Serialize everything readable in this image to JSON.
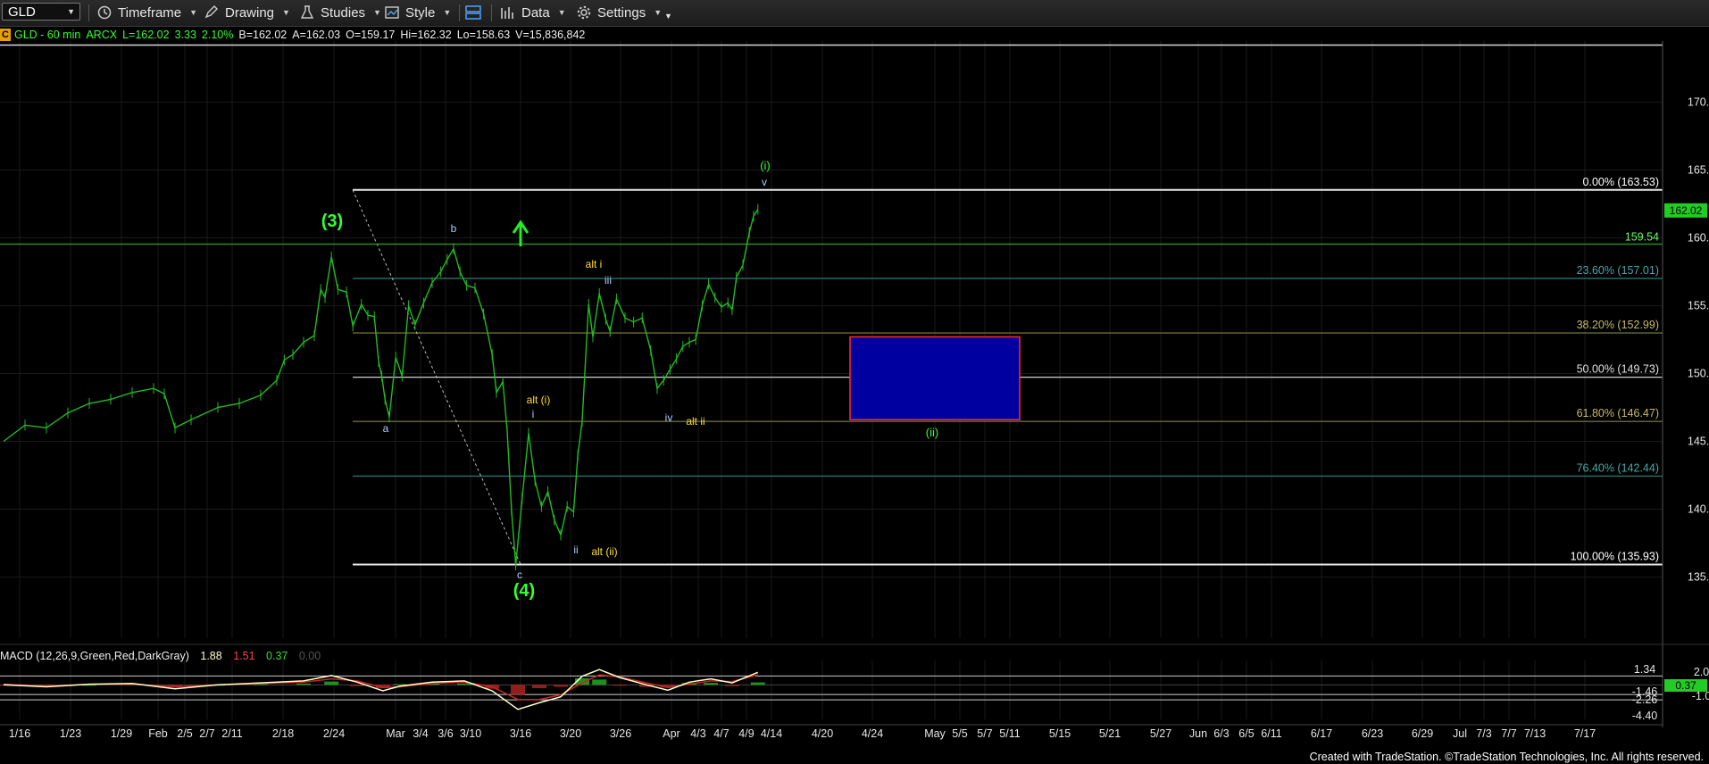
{
  "toolbar": {
    "symbol": "GLD",
    "items": [
      "Timeframe",
      "Drawing",
      "Studies",
      "Style",
      "Data",
      "Settings"
    ]
  },
  "infobar": {
    "badge": "C",
    "symbol_desc": "GLD - 60 min",
    "exchange": "ARCX",
    "last": "L=162.02",
    "change": "3.33",
    "pct": "2.10%",
    "bid": "B=162.02",
    "ask": "A=162.03",
    "open": "O=159.17",
    "high": "Hi=162.32",
    "low": "Lo=158.63",
    "volume": "V=15,836,842"
  },
  "macd_header": {
    "label": "MACD (12,26,9,Green,Red,DarkGray)",
    "macd": "1.88",
    "signal": "1.51",
    "hist": "0.37",
    "zero": "0.00"
  },
  "footer": "Created with TradeStation. ©TradeStation Technologies, Inc. All rights reserved.",
  "colors": {
    "price_up": "#22bb22",
    "price_label": "#33ff33",
    "fib_line": "#e0e0e0",
    "target_box_fill": "#0000a0",
    "target_box_border": "#ff2a2a",
    "macd_line": "#ffffcc",
    "signal_line": "#cc2222",
    "hist_pos": "#22aa22",
    "hist_neg": "#aa2222"
  },
  "chart_data": {
    "type": "line",
    "title": "GLD - 60 min",
    "ylim": [
      130.5,
      174.5
    ],
    "y_ticks": [
      135.0,
      140.0,
      145.0,
      150.0,
      155.0,
      160.0,
      165.0,
      170.0
    ],
    "x_labels": [
      "1/16",
      "1/23",
      "1/29",
      "Feb",
      "2/5",
      "2/7",
      "2/11",
      "2/18",
      "2/24",
      "Mar",
      "3/4",
      "3/6",
      "3/10",
      "3/16",
      "3/20",
      "3/26",
      "Apr",
      "4/3",
      "4/7",
      "4/9",
      "4/14",
      "4/20",
      "4/24",
      "May",
      "5/5",
      "5/7",
      "5/11",
      "5/15",
      "5/21",
      "5/27",
      "Jun",
      "6/3",
      "6/5",
      "6/11",
      "6/17",
      "6/23",
      "6/29",
      "Jul",
      "7/3",
      "7/7",
      "7/13",
      "7/17"
    ],
    "price_path": [
      [
        0,
        145.0
      ],
      [
        20,
        146.2
      ],
      [
        40,
        146.0
      ],
      [
        60,
        147.1
      ],
      [
        80,
        147.8
      ],
      [
        100,
        148.1
      ],
      [
        120,
        148.6
      ],
      [
        140,
        148.9
      ],
      [
        150,
        148.5
      ],
      [
        160,
        146.0
      ],
      [
        175,
        146.6
      ],
      [
        200,
        147.5
      ],
      [
        220,
        147.8
      ],
      [
        240,
        148.4
      ],
      [
        255,
        149.5
      ],
      [
        262,
        151.0
      ],
      [
        270,
        151.4
      ],
      [
        280,
        152.3
      ],
      [
        290,
        152.8
      ],
      [
        296,
        156.2
      ],
      [
        300,
        155.6
      ],
      [
        306,
        158.6
      ],
      [
        312,
        156.2
      ],
      [
        320,
        156.0
      ],
      [
        326,
        153.5
      ],
      [
        334,
        155.1
      ],
      [
        340,
        154.3
      ],
      [
        346,
        154.2
      ],
      [
        350,
        150.9
      ],
      [
        353,
        149.8
      ],
      [
        356,
        148.1
      ],
      [
        360,
        146.8
      ],
      [
        366,
        151.2
      ],
      [
        372,
        149.8
      ],
      [
        378,
        155.0
      ],
      [
        384,
        153.6
      ],
      [
        392,
        155.2
      ],
      [
        400,
        156.7
      ],
      [
        408,
        157.5
      ],
      [
        414,
        158.4
      ],
      [
        420,
        159.2
      ],
      [
        426,
        157.5
      ],
      [
        432,
        156.5
      ],
      [
        440,
        156.3
      ],
      [
        448,
        154.4
      ],
      [
        456,
        151.4
      ],
      [
        460,
        148.6
      ],
      [
        466,
        149.4
      ],
      [
        470,
        145.8
      ],
      [
        474,
        140.0
      ],
      [
        478,
        135.9
      ],
      [
        484,
        140.8
      ],
      [
        490,
        145.6
      ],
      [
        496,
        142.1
      ],
      [
        502,
        140.2
      ],
      [
        508,
        141.3
      ],
      [
        514,
        139.2
      ],
      [
        520,
        138.1
      ],
      [
        526,
        140.2
      ],
      [
        532,
        139.8
      ],
      [
        536,
        144.0
      ],
      [
        540,
        146.5
      ],
      [
        546,
        155.1
      ],
      [
        550,
        152.7
      ],
      [
        556,
        155.9
      ],
      [
        562,
        154.0
      ],
      [
        566,
        153.1
      ],
      [
        572,
        155.5
      ],
      [
        580,
        154.1
      ],
      [
        588,
        153.8
      ],
      [
        596,
        154.1
      ],
      [
        604,
        151.7
      ],
      [
        610,
        148.9
      ],
      [
        616,
        149.5
      ],
      [
        622,
        150.3
      ],
      [
        628,
        151.1
      ],
      [
        634,
        152.0
      ],
      [
        640,
        152.3
      ],
      [
        646,
        152.5
      ],
      [
        652,
        155.0
      ],
      [
        658,
        156.6
      ],
      [
        664,
        155.6
      ],
      [
        670,
        154.9
      ],
      [
        676,
        155.2
      ],
      [
        680,
        154.7
      ],
      [
        684,
        157.1
      ],
      [
        690,
        158.0
      ],
      [
        696,
        160.4
      ],
      [
        700,
        161.6
      ],
      [
        704,
        162.1
      ]
    ],
    "fib_levels": [
      {
        "label": "0.00% (163.53)",
        "price": 163.53
      },
      {
        "label": "23.60% (157.01)",
        "price": 157.01
      },
      {
        "label": "38.20% (152.99)",
        "price": 152.99
      },
      {
        "label": "50.00% (149.73)",
        "price": 149.73
      },
      {
        "label": "61.80% (146.47)",
        "price": 146.47
      },
      {
        "label": "76.40% (142.44)",
        "price": 142.44
      },
      {
        "label": "100.00% (135.93)",
        "price": 135.93
      }
    ],
    "top_line_price": 174.2,
    "support_line": {
      "label": "159.54",
      "price": 159.54
    },
    "last_price_label": "162.02",
    "target_box": {
      "price_high": 152.7,
      "price_low": 146.6
    },
    "wave_labels": [
      {
        "text": "(3)",
        "color": "#33ff33",
        "big": true
      },
      {
        "text": "(4)",
        "color": "#33ff33",
        "big": true
      },
      {
        "text": "(i)",
        "color": "#33ff33",
        "big": false
      },
      {
        "text": "(ii)",
        "color": "#33ff33",
        "big": false
      },
      {
        "text": "a",
        "color": "#aaccff",
        "big": false
      },
      {
        "text": "b",
        "color": "#aaccff",
        "big": false
      },
      {
        "text": "c",
        "color": "#aaccff",
        "big": false
      },
      {
        "text": "i",
        "color": "#aaccff",
        "big": false
      },
      {
        "text": "ii",
        "color": "#aaccff",
        "big": false
      },
      {
        "text": "iii",
        "color": "#aaccff",
        "big": false
      },
      {
        "text": "iv",
        "color": "#aaccff",
        "big": false
      },
      {
        "text": "v",
        "color": "#aaccff",
        "big": false
      },
      {
        "text": "alt i",
        "color": "#ffdd33",
        "big": false
      },
      {
        "text": "alt (i)",
        "color": "#ffdd33",
        "big": false
      },
      {
        "text": "alt (ii)",
        "color": "#ffdd33",
        "big": false
      },
      {
        "text": "alt ii",
        "color": "#ffdd33",
        "big": false
      }
    ],
    "macd": {
      "ylim": [
        -4.4,
        2.6
      ],
      "y_labels": [
        "2.00",
        "1.34",
        "0.37",
        "-1.00",
        "-1.46",
        "-2.26",
        "-4.40"
      ],
      "macd_path": [
        [
          0,
          0.0
        ],
        [
          40,
          -0.3
        ],
        [
          80,
          0.1
        ],
        [
          120,
          0.2
        ],
        [
          160,
          -0.6
        ],
        [
          200,
          0.0
        ],
        [
          240,
          0.3
        ],
        [
          280,
          0.6
        ],
        [
          306,
          1.4
        ],
        [
          330,
          0.4
        ],
        [
          354,
          -0.9
        ],
        [
          370,
          -0.2
        ],
        [
          400,
          0.4
        ],
        [
          430,
          0.6
        ],
        [
          456,
          -0.9
        ],
        [
          480,
          -3.7
        ],
        [
          500,
          -2.7
        ],
        [
          520,
          -1.8
        ],
        [
          540,
          1.3
        ],
        [
          556,
          2.3
        ],
        [
          575,
          1.1
        ],
        [
          600,
          0.0
        ],
        [
          620,
          -0.8
        ],
        [
          640,
          0.4
        ],
        [
          660,
          0.9
        ],
        [
          680,
          0.3
        ],
        [
          704,
          1.88
        ]
      ],
      "signal_path": [
        [
          0,
          0.1
        ],
        [
          40,
          -0.2
        ],
        [
          80,
          0.1
        ],
        [
          120,
          0.1
        ],
        [
          160,
          -0.3
        ],
        [
          200,
          0.0
        ],
        [
          240,
          0.2
        ],
        [
          280,
          0.4
        ],
        [
          306,
          0.9
        ],
        [
          330,
          0.6
        ],
        [
          354,
          -0.4
        ],
        [
          370,
          -0.3
        ],
        [
          400,
          0.2
        ],
        [
          430,
          0.4
        ],
        [
          456,
          -0.3
        ],
        [
          480,
          -2.2
        ],
        [
          500,
          -2.2
        ],
        [
          520,
          -1.5
        ],
        [
          540,
          0.3
        ],
        [
          556,
          1.5
        ],
        [
          575,
          1.2
        ],
        [
          600,
          0.3
        ],
        [
          620,
          -0.4
        ],
        [
          640,
          0.1
        ],
        [
          660,
          0.6
        ],
        [
          680,
          0.5
        ],
        [
          704,
          1.51
        ]
      ]
    }
  }
}
